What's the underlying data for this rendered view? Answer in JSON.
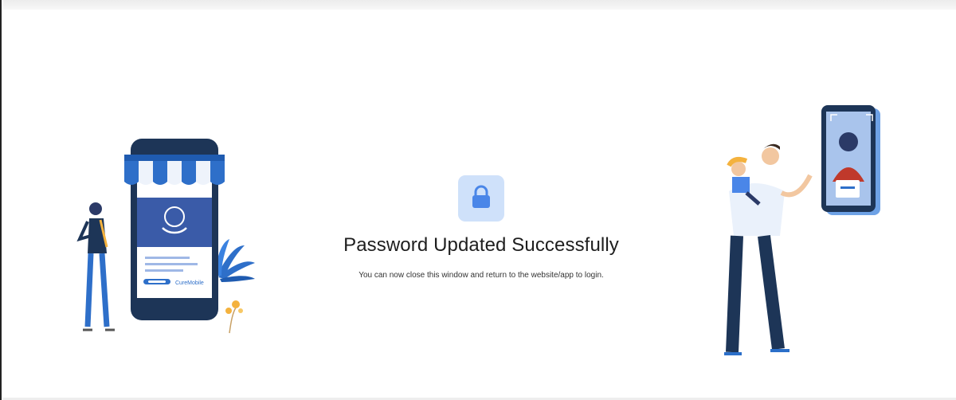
{
  "status": {
    "title": "Password Updated Successfully",
    "message": "You can now close this window and return to the website/app to login."
  },
  "icons": {
    "status": "lock-icon"
  },
  "brand": {
    "app_label": "CureMobile"
  },
  "colors": {
    "accent": "#4a86e8",
    "tile": "#cfe1fa",
    "navy": "#1d3557"
  }
}
